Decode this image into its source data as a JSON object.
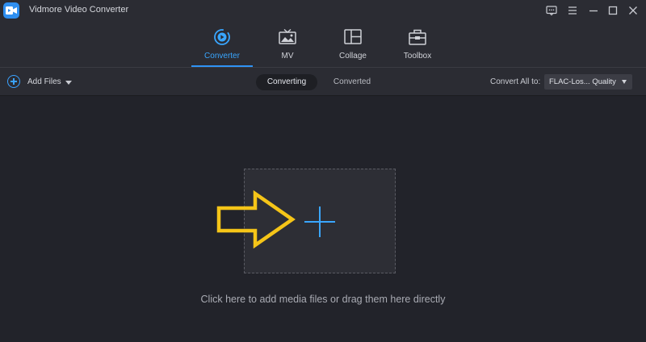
{
  "window": {
    "title": "Vidmore Video Converter",
    "icons": [
      "app-logo-icon",
      "feedback-icon",
      "menu-icon",
      "minimize-icon",
      "maximize-icon",
      "close-icon"
    ]
  },
  "modes": {
    "tabs": [
      {
        "label": "Converter",
        "icon": "converter-icon",
        "active": true
      },
      {
        "label": "MV",
        "icon": "mv-icon",
        "active": false
      },
      {
        "label": "Collage",
        "icon": "collage-icon",
        "active": false
      },
      {
        "label": "Toolbox",
        "icon": "toolbox-icon",
        "active": false
      }
    ]
  },
  "toolbar": {
    "add_files_label": "Add Files",
    "segments": [
      {
        "label": "Converting",
        "active": true
      },
      {
        "label": "Converted",
        "active": false
      }
    ],
    "convert_all_label": "Convert All to:",
    "format_value": "FLAC-Los... Quality"
  },
  "main": {
    "hint": "Click here to add media files or drag them here directly"
  },
  "colors": {
    "accent": "#2f93f5",
    "background": "#22232a",
    "panel": "#2b2c33",
    "annotation_arrow": "#f5c518"
  }
}
